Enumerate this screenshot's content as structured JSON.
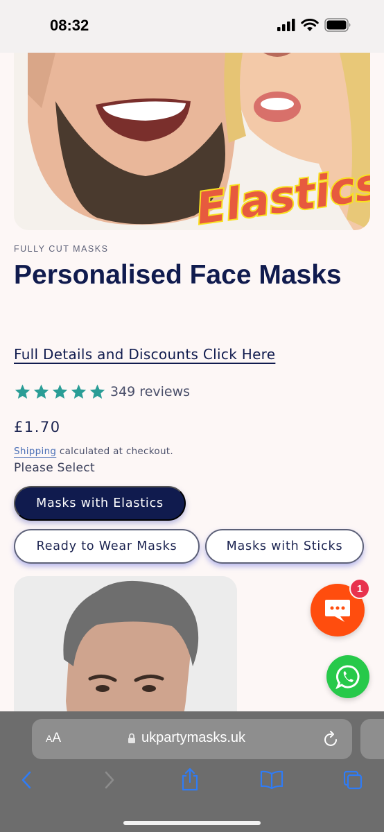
{
  "status_bar": {
    "time": "08:32"
  },
  "hero": {
    "overlay_text": "Elastics"
  },
  "product": {
    "vendor": "FULLY CUT MASKS",
    "title": "Personalised Face Masks",
    "details_link": "Full Details and Discounts Click Here",
    "rating": {
      "stars": 5,
      "reviews_text": "349 reviews"
    },
    "price": "£1.70",
    "shipping_link": "Shipping",
    "shipping_text": " calculated at checkout.",
    "please_select": "Please Select",
    "variants": [
      {
        "label": "Masks with Elastics",
        "selected": true
      },
      {
        "label": "Ready to Wear Masks",
        "selected": false
      },
      {
        "label": "Masks with Sticks",
        "selected": false
      }
    ]
  },
  "chat_widget": {
    "badge_count": "1"
  },
  "browser": {
    "aa_label_small": "A",
    "aa_label_large": "A",
    "url": "ukpartymasks.uk"
  },
  "colors": {
    "brand_navy": "#101b4e",
    "star_teal": "#2a9d96",
    "chat_orange": "#ff4d0e",
    "whatsapp_green": "#27c94a",
    "badge_red": "#e8324e"
  }
}
